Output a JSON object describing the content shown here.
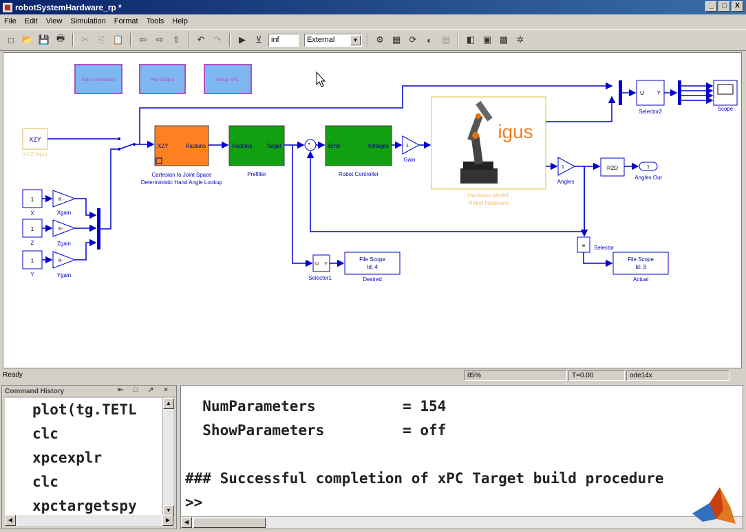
{
  "window": {
    "title": "robotSystemHardware_rp *",
    "min": "_",
    "max": "□",
    "close": "X"
  },
  "menu": [
    "File",
    "Edit",
    "View",
    "Simulation",
    "Format",
    "Tools",
    "Help"
  ],
  "toolbar": {
    "stop_time": "inf",
    "mode": "External"
  },
  "model": {
    "top_buttons": [
      "Start Simulation",
      "Plot Output",
      "Setup xPC"
    ],
    "xzy_source": "XZY",
    "xzy_source_caption": "XYZ Input",
    "constants": [
      {
        "value": "1",
        "label": "X",
        "gain": "K-",
        "gain_label": "Xgain"
      },
      {
        "value": "1",
        "label": "Z",
        "gain": "K-",
        "gain_label": "Zgain"
      },
      {
        "value": "1",
        "label": "Y",
        "gain": "K-",
        "gain_label": "Ygain"
      }
    ],
    "cartesian": {
      "in": "XZY",
      "out": "Radians",
      "caption1": "Cartesian to Joint Space",
      "caption2": "Deterministic Hand Angle Lookup"
    },
    "prefilter": {
      "in": "Radians",
      "out": "Target",
      "caption": "Prefilter"
    },
    "controller": {
      "in": "Error",
      "out": "Voltages",
      "caption": "Robot Controller"
    },
    "gain1": {
      "value": "1",
      "caption": "Gain"
    },
    "hardware": {
      "logo": "igus",
      "caption1": "Hardware Model:",
      "caption2": "Robot Hardware"
    },
    "angles": {
      "value": "1",
      "caption": "Angles"
    },
    "r2d": "R2D",
    "angles_out": {
      "value": "1",
      "caption": "Angles Out"
    },
    "selector2": {
      "in": "U",
      "out": "Y",
      "caption": "Selector2"
    },
    "scope": {
      "caption": "Scope"
    },
    "selector1": {
      "in": "U",
      "out": "Y",
      "caption": "Selector1"
    },
    "filescope_desired": {
      "line1": "File Scope",
      "line2": "Id: 4",
      "caption": "Desired"
    },
    "selector": {
      "caption": "Selector"
    },
    "filescope_actual": {
      "line1": "File Scope",
      "line2": "Id: 3",
      "caption": "Actual"
    }
  },
  "status": {
    "left": "Ready",
    "zoom": "85%",
    "time": "T=0.00",
    "solver": "ode14x"
  },
  "command_history": {
    "title": "Command History",
    "controls": "⇤ □ ↗ ×",
    "items": [
      "plot(tg.TETL",
      "clc",
      "xpcexplr",
      "clc",
      "xpctargetspy"
    ]
  },
  "console": {
    "lines": [
      "  NumParameters          = 154",
      "  ShowParameters         = off",
      "",
      "### Successful completion of xPC Target build procedure",
      ">>"
    ]
  }
}
